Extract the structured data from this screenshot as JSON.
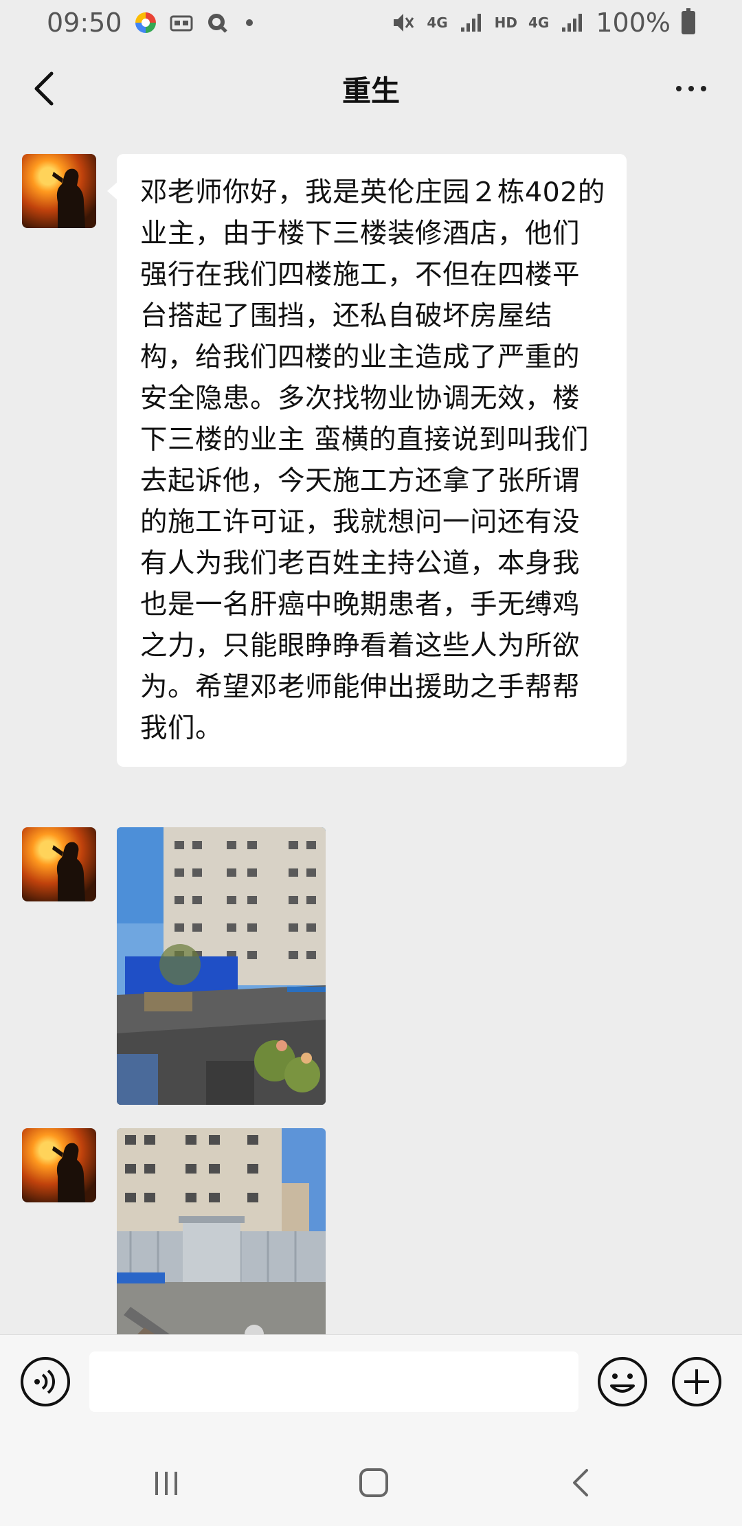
{
  "status_bar": {
    "time": "09:50",
    "network_1": "4G",
    "hd": "HD",
    "network_2": "4G",
    "battery": "100%"
  },
  "header": {
    "title": "重生"
  },
  "messages": [
    {
      "type": "text",
      "text": "邓老师你好，我是英伦庄园２栋402的业主，由于楼下三楼装修酒店，他们强行在我们四楼施工，不但在四楼平台搭起了围挡，还私自破坏房屋结构，给我们四楼的业主造成了严重的安全隐患。多次找物业协调无效，楼下三楼的业主 蛮横的直接说到叫我们去起诉他，今天施工方还拿了张所谓的施工许可证，我就想问一问还有没有人为我们老百姓主持公道，本身我也是一名肝癌中晚期患者，手无缚鸡之力，只能眼睁睁看着这些人为所欲为。希望邓老师能伸出援助之手帮帮我们。"
    },
    {
      "type": "image",
      "subject": "rooftop-blue-barrier-photo"
    },
    {
      "type": "image",
      "subject": "rooftop-metal-hut-photo"
    }
  ],
  "input_bar": {
    "voice_icon": "voice-icon",
    "emoji_icon": "emoji-icon",
    "plus_icon": "plus-icon"
  },
  "colors": {
    "background": "#ededed",
    "bubble": "#ffffff",
    "bar": "#f6f6f6"
  }
}
